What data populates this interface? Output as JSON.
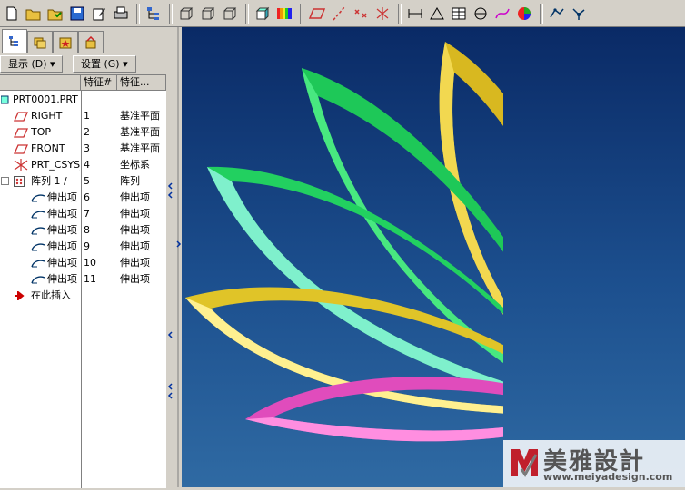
{
  "toolbar": {
    "icons": [
      "new-file",
      "open-folder",
      "open-recent",
      "save",
      "edit",
      "print",
      "tree-view",
      "view-cube-1",
      "view-cube-2",
      "view-cube-3",
      "view-shaded",
      "color-bar",
      "datum-plane",
      "datum-axis",
      "datum-point",
      "datum-csys",
      "measure",
      "angle",
      "table",
      "analysis",
      "curve",
      "appearance",
      "sketch",
      "network"
    ]
  },
  "panel": {
    "tabs": [
      "model-tree",
      "layers",
      "favorites",
      "tools"
    ],
    "menu": {
      "show_label": "显示 (D) ▾",
      "settings_label": "设置 (G) ▾"
    },
    "columns": {
      "id": "特征#",
      "type": "特征..."
    }
  },
  "tree": {
    "root": "PRT0001.PRT",
    "rows": [
      {
        "name": "RIGHT",
        "id": "1",
        "type": "基准平面",
        "icon": "datum-plane-icon"
      },
      {
        "name": "TOP",
        "id": "2",
        "type": "基准平面",
        "icon": "datum-plane-icon"
      },
      {
        "name": "FRONT",
        "id": "3",
        "type": "基准平面",
        "icon": "datum-plane-icon"
      },
      {
        "name": "PRT_CSYS_",
        "id": "4",
        "type": "坐标系",
        "icon": "csys-icon"
      },
      {
        "name": "阵列 1 /",
        "id": "5",
        "type": "阵列",
        "icon": "pattern-icon"
      },
      {
        "name": "伸出项",
        "id": "6",
        "type": "伸出项",
        "icon": "protrusion-icon"
      },
      {
        "name": "伸出项",
        "id": "7",
        "type": "伸出项",
        "icon": "protrusion-icon"
      },
      {
        "name": "伸出项",
        "id": "8",
        "type": "伸出项",
        "icon": "protrusion-icon"
      },
      {
        "name": "伸出项",
        "id": "9",
        "type": "伸出项",
        "icon": "protrusion-icon"
      },
      {
        "name": "伸出项",
        "id": "10",
        "type": "伸出项",
        "icon": "protrusion-icon"
      },
      {
        "name": "伸出项",
        "id": "11",
        "type": "伸出项",
        "icon": "protrusion-icon"
      }
    ],
    "insert_here": "在此插入"
  },
  "watermark": {
    "title": "美雅設計",
    "url": "www.meiyadesign.com"
  },
  "colors": {
    "pink": "#e448b8",
    "yellow": "#e8c830",
    "green": "#2ee06a",
    "cyan": "#7af0d8",
    "bg": "#1a4a8a"
  }
}
